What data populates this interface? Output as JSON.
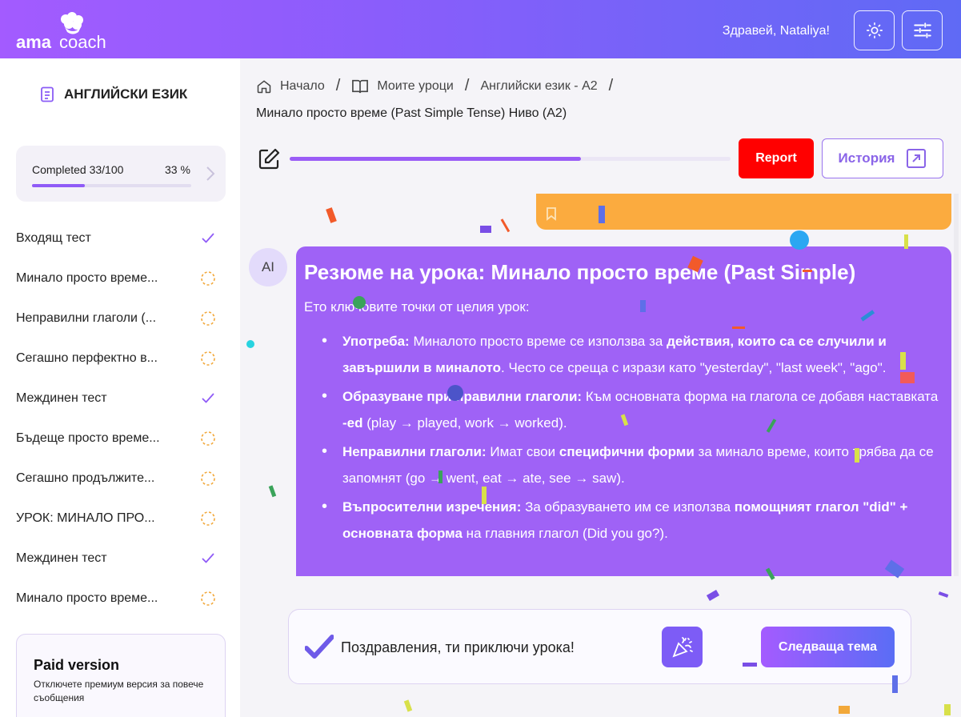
{
  "header": {
    "logo_text": "ama coach",
    "greeting": "Здравей, Nataliya!",
    "theme_icon": "sun-icon",
    "settings_icon": "sliders-icon",
    "gradient": [
      "#a35bff",
      "#5f6af5"
    ]
  },
  "sidebar": {
    "subject": "АНГЛИЙСКИ ЕЗИК",
    "progress": {
      "label": "Completed 33/100",
      "percent_text": "33 %",
      "fraction": 0.33
    },
    "lessons": [
      {
        "label": "Входящ тест",
        "status": "done"
      },
      {
        "label": "Минало просто време...",
        "status": "pending"
      },
      {
        "label": "Неправилни глаголи (...",
        "status": "pending"
      },
      {
        "label": "Сегашно перфектно в...",
        "status": "pending"
      },
      {
        "label": "Междинен тест",
        "status": "done"
      },
      {
        "label": "Бъдеще просто време...",
        "status": "pending"
      },
      {
        "label": "Сегашно продължите...",
        "status": "pending"
      },
      {
        "label": "УРОК: МИНАЛО ПРО...",
        "status": "pending"
      },
      {
        "label": "Междинен тест",
        "status": "done"
      },
      {
        "label": "Минало просто време...",
        "status": "pending"
      }
    ],
    "paid": {
      "title": "Paid version",
      "description": "Отключете премиум версия за повече съобщения"
    }
  },
  "main": {
    "breadcrumb": [
      {
        "label": "Начало",
        "icon": "home-icon"
      },
      {
        "label": "Моите уроци",
        "icon": "book-icon"
      },
      {
        "label": "Английски език - A2",
        "icon": ""
      }
    ],
    "lesson_title": "Минало просто време (Past Simple Tense) Ниво (A2)",
    "lesson_progress": 0.66,
    "report_label": "Report",
    "history_label": "История",
    "accent_red": "#ff0000",
    "accent_purple": "#9f62f6"
  },
  "chat": {
    "avatar_label": "AI",
    "heading": "Резюме на урока: Минало просто време (Past Simple)",
    "intro": "Ето ключовите точки от целия урок:",
    "points": [
      {
        "title": "Употреба:",
        "t1": " Миналото просто време се използва за ",
        "b1": "действия, които са се случили и завършили в миналото",
        "t2": ". Често се среща с изрази като \"yesterday\", \"last week\", \"ago\"."
      },
      {
        "title": "Образуване при правилни глаголи:",
        "t1": " Към основната форма на глагола се добавя наставката ",
        "b1": "-ed",
        "t2": " (play → played, work → worked)."
      },
      {
        "title": "Неправилни глаголи:",
        "t1": " Имат свои ",
        "b1": "специфични форми",
        "t2": " за минало време, които трябва да се запомнят (go → went, eat → ate, see → saw)."
      },
      {
        "title": "Въпросителни изречения:",
        "t1": " За образуването им се използва ",
        "b1": "помощният глагол \"did\" + основната форма",
        "t2": " на главния глагол (Did you go?)."
      }
    ]
  },
  "completion": {
    "message": "Поздравления, ти приключи урока!",
    "party_icon": "party-popper-icon",
    "next_label": "Следваща тема"
  }
}
